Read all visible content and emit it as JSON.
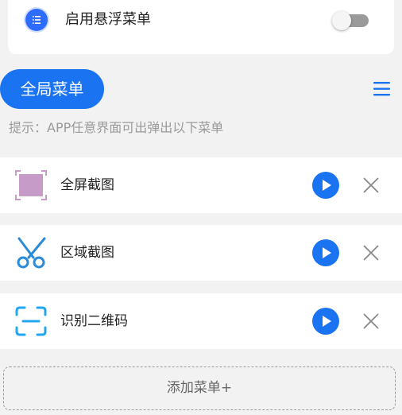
{
  "floating_menu": {
    "label": "启用悬浮菜单",
    "icon": "list-icon",
    "enabled": false
  },
  "global_menu": {
    "title": "全局菜单",
    "menu_icon": "hamburger-icon",
    "hint": "提示：APP任意界面可出弹出以下菜单"
  },
  "menu_items": [
    {
      "label": "全屏截图",
      "icon": "fullscreen-screenshot-icon"
    },
    {
      "label": "区域截图",
      "icon": "scissors-icon"
    },
    {
      "label": "识别二维码",
      "icon": "qr-scan-icon"
    }
  ],
  "add_button": {
    "label": "添加菜单+"
  },
  "colors": {
    "accent": "#1a73f0",
    "background": "#f2f2f2",
    "card": "#ffffff",
    "hint_text": "#9a9a9a",
    "screenshot_icon": "#c79bc7",
    "scissors_icon": "#2b8bd8",
    "scan_icon": "#23a6f0"
  }
}
